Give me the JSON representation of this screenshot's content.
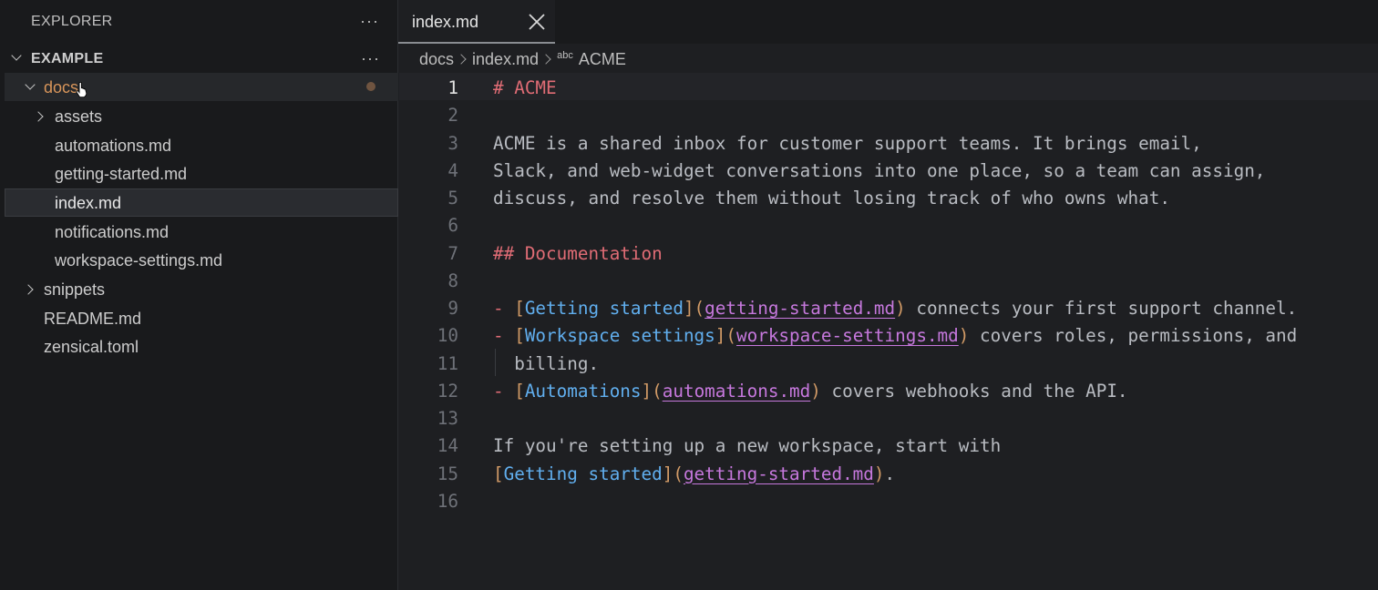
{
  "sidebar": {
    "title": "EXPLORER",
    "more_label": "···",
    "section": {
      "title": "EXAMPLE",
      "more_label": "···"
    },
    "tree": [
      {
        "label": "docs",
        "type": "folder",
        "expanded": true,
        "modified": true
      },
      {
        "label": "assets",
        "type": "folder",
        "expanded": false
      },
      {
        "label": "automations.md",
        "type": "file"
      },
      {
        "label": "getting-started.md",
        "type": "file"
      },
      {
        "label": "index.md",
        "type": "file",
        "selected": true
      },
      {
        "label": "notifications.md",
        "type": "file"
      },
      {
        "label": "workspace-settings.md",
        "type": "file"
      },
      {
        "label": "snippets",
        "type": "folder",
        "expanded": false
      },
      {
        "label": "README.md",
        "type": "file"
      },
      {
        "label": "zensical.toml",
        "type": "file"
      }
    ]
  },
  "tabs": [
    {
      "label": "index.md",
      "active": true
    }
  ],
  "breadcrumb": {
    "items": [
      "docs",
      "index.md"
    ],
    "symbol_icon": "abc",
    "symbol": "ACME"
  },
  "editor": {
    "current_line": 1,
    "lines": [
      {
        "n": "1",
        "text": "# ACME"
      },
      {
        "n": "2",
        "text": ""
      },
      {
        "n": "3",
        "text": "ACME is a shared inbox for customer support teams. It brings email,"
      },
      {
        "n": "4",
        "text": "Slack, and web-widget conversations into one place, so a team can assign,"
      },
      {
        "n": "5",
        "text": "discuss, and resolve them without losing track of who owns what."
      },
      {
        "n": "6",
        "text": ""
      },
      {
        "n": "7",
        "text": "## Documentation"
      },
      {
        "n": "8",
        "text": ""
      },
      {
        "n": "9",
        "text": "- [Getting started](getting-started.md) connects your first support channel."
      },
      {
        "n": "10",
        "text": "- [Workspace settings](workspace-settings.md) covers roles, permissions, and"
      },
      {
        "n": "11",
        "text": "  billing."
      },
      {
        "n": "12",
        "text": "- [Automations](automations.md) covers webhooks and the API."
      },
      {
        "n": "13",
        "text": ""
      },
      {
        "n": "14",
        "text": "If you're setting up a new workspace, start with"
      },
      {
        "n": "15",
        "text": "[Getting started](getting-started.md)."
      },
      {
        "n": "16",
        "text": ""
      }
    ]
  },
  "colors": {
    "heading": "#e06c75",
    "link_text": "#61afef",
    "link_url": "#c678dd",
    "bracket": "#d19a66",
    "modified_folder": "#d8955a"
  }
}
